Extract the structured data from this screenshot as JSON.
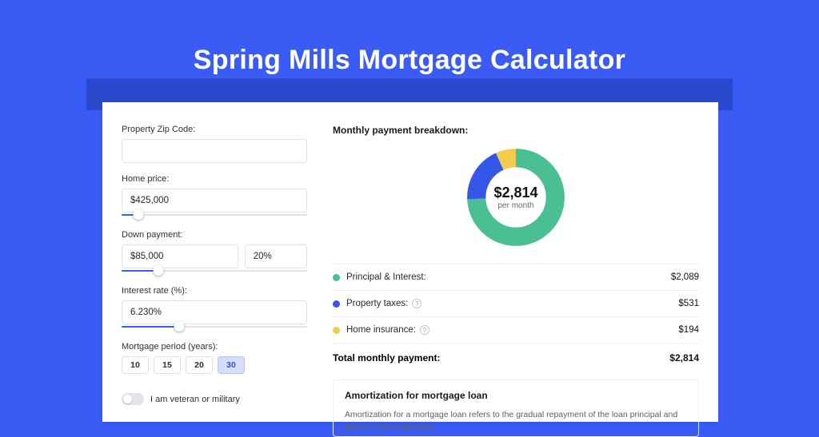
{
  "page": {
    "title": "Spring Mills Mortgage Calculator"
  },
  "form": {
    "zip": {
      "label": "Property Zip Code:",
      "value": ""
    },
    "home_price": {
      "label": "Home price:",
      "value": "$425,000",
      "slider_pct": 9
    },
    "down_payment": {
      "label": "Down payment:",
      "amount": "$85,000",
      "percent": "20%",
      "slider_pct": 20
    },
    "interest": {
      "label": "Interest rate (%):",
      "value": "6.230%",
      "slider_pct": 31
    },
    "period": {
      "label": "Mortgage period (years):",
      "options": [
        "10",
        "15",
        "20",
        "30"
      ],
      "selected": "30"
    },
    "veteran": {
      "label": "I am veteran or military",
      "checked": false
    }
  },
  "breakdown": {
    "title": "Monthly payment breakdown:",
    "center_value": "$2,814",
    "center_sub": "per month",
    "items": [
      {
        "label": "Principal & Interest:",
        "value": "$2,089",
        "color": "#4bbf94",
        "info": false
      },
      {
        "label": "Property taxes:",
        "value": "$531",
        "color": "#3557e8",
        "info": true
      },
      {
        "label": "Home insurance:",
        "value": "$194",
        "color": "#f3cc4d",
        "info": true
      }
    ],
    "total_label": "Total monthly payment:",
    "total_value": "$2,814"
  },
  "amort": {
    "title": "Amortization for mortgage loan",
    "text": "Amortization for a mortgage loan refers to the gradual repayment of the loan principal and interest over a specified"
  },
  "chart_data": {
    "type": "pie",
    "title": "Monthly payment breakdown",
    "series": [
      {
        "name": "Principal & Interest",
        "value": 2089,
        "color": "#4bbf94"
      },
      {
        "name": "Property taxes",
        "value": 531,
        "color": "#3557e8"
      },
      {
        "name": "Home insurance",
        "value": 194,
        "color": "#f3cc4d"
      }
    ],
    "total": 2814,
    "center_label": "$2,814 per month"
  }
}
